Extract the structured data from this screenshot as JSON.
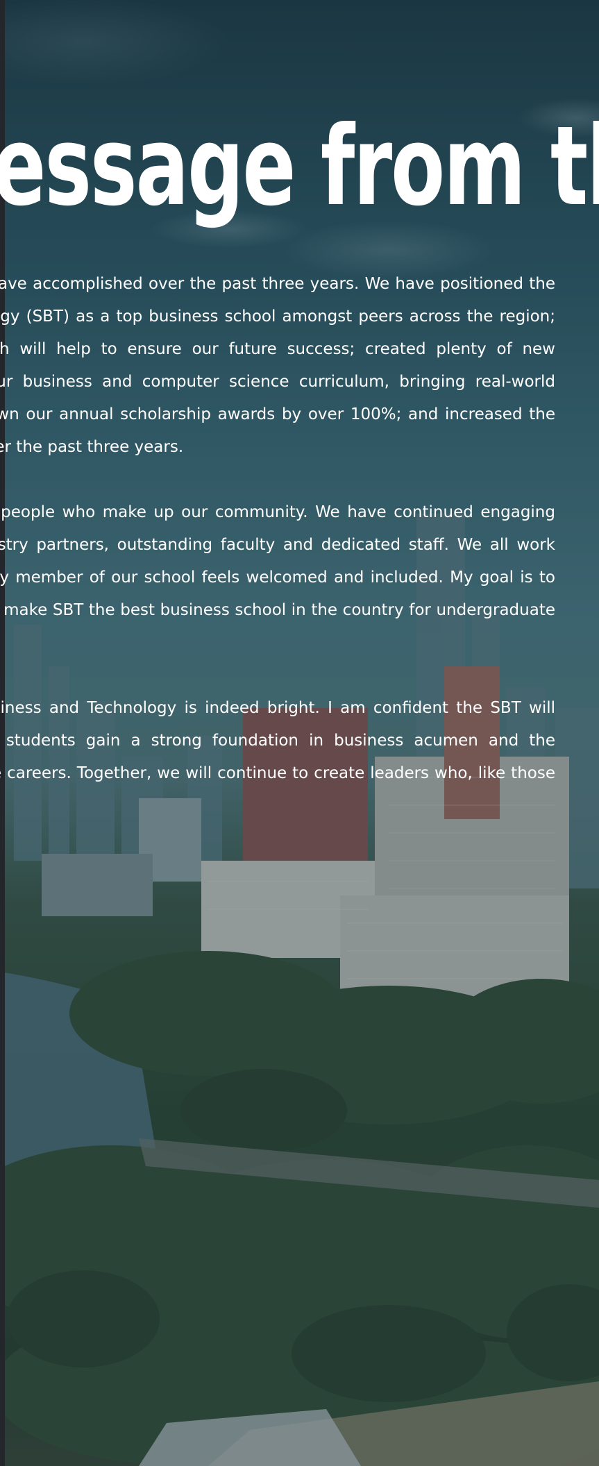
{
  "page": {
    "heading": "A Message from the Dean",
    "paragraphs": [
      "I am incredibly proud of all we have accomplished over the past three years. We have positioned the School of Business and Technology (SBT) as a top business school amongst peers across the region; adopted a strategic plan, which will help to ensure our future success; created plenty of new partnerships that strengthen our business and computer science curriculum, bringing real-world relevance to the classroom; grown our annual scholarship awards by over 100%; and increased the number of students we serve over the past three years.",
      "I am grateful for the wonderful people who make up our community. We have continued engaging with our students, alumni, industry partners, outstanding faculty and dedicated staff. We all work together to make sure that every member of our school feels welcomed and included. My goal is to work with all our stakeholders to make SBT the best business school in the country for undergraduate and graduate education.",
      "The future of the School of Business and Technology is indeed bright. I am confident the SBT will continue to be a place where students gain a strong foundation in business acumen and the competencies required for future careers. Together, we will continue to create leaders who, like those before us, will significantly"
    ]
  },
  "colors": {
    "text": "#ffffff",
    "left_bar": "#23272c",
    "overlay": "#14283c"
  }
}
